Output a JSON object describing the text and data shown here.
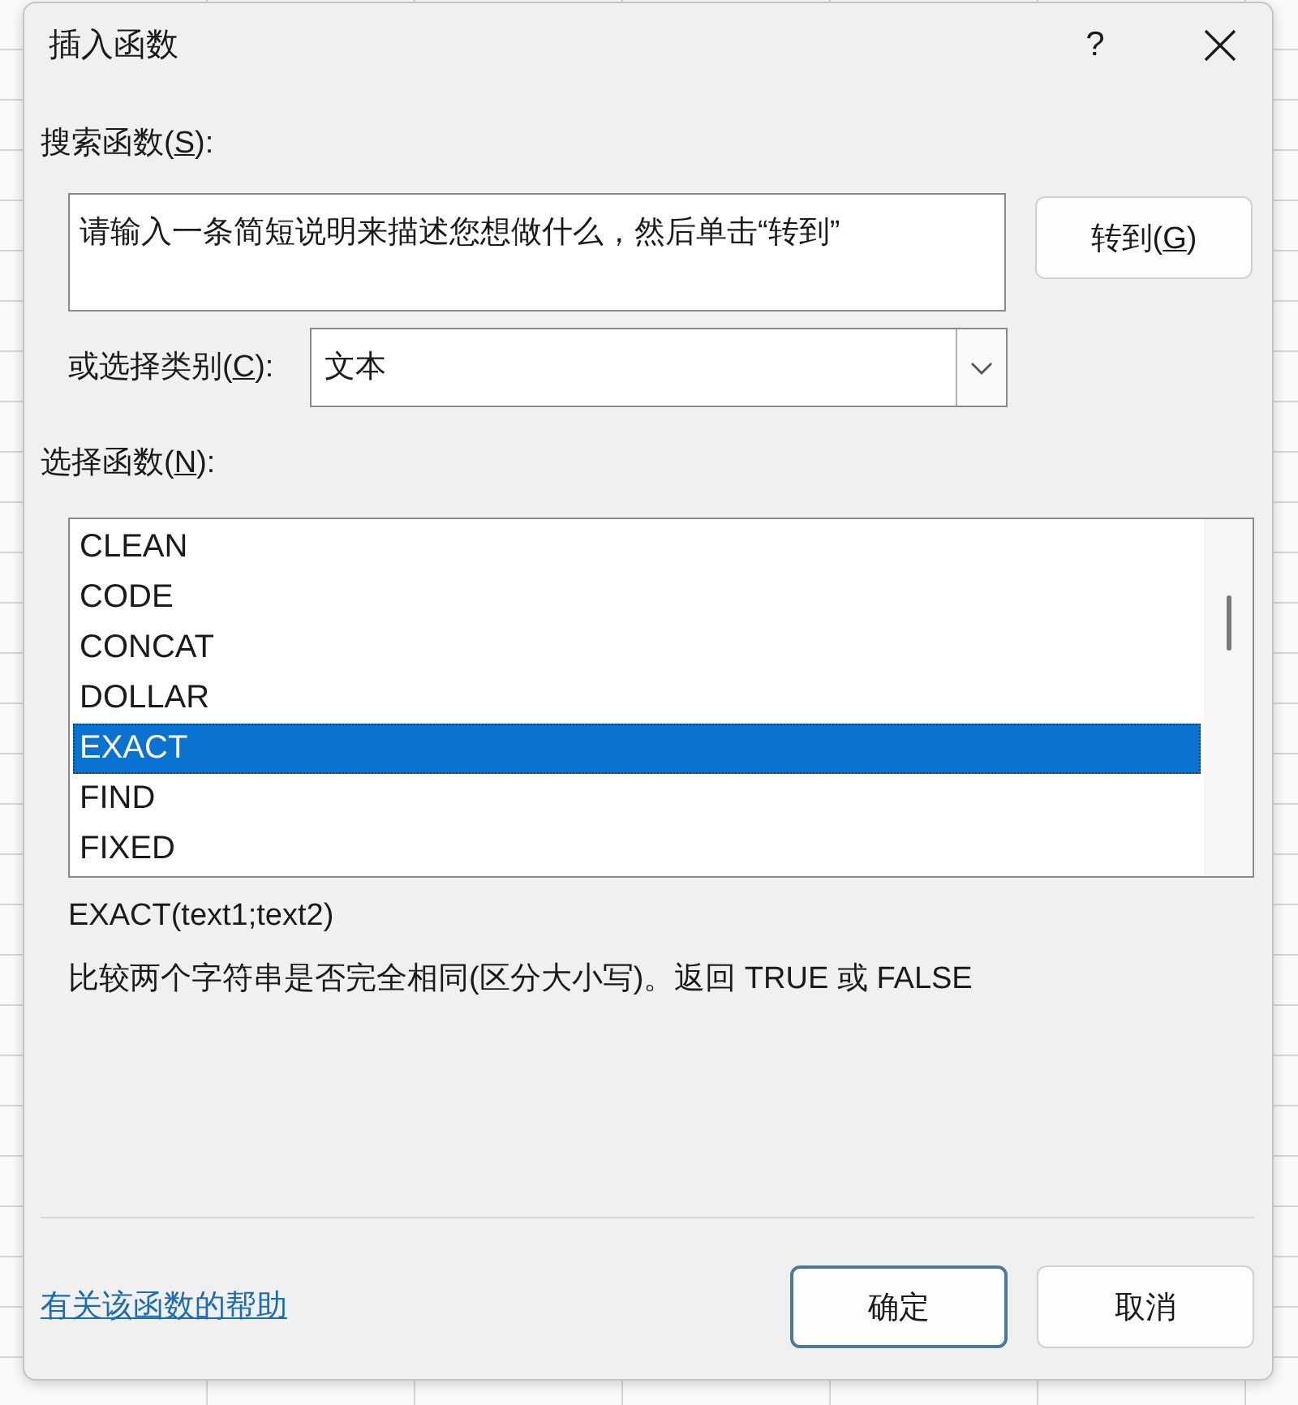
{
  "window": {
    "title": "插入函数",
    "help_button": "?"
  },
  "search": {
    "label": {
      "prefix": "搜索函数(",
      "key": "S",
      "suffix": "):"
    },
    "value": "请输入一条简短说明来描述您想做什么，然后单击“转到”",
    "go_button": {
      "prefix": "转到(",
      "key": "G",
      "suffix": ")"
    }
  },
  "category": {
    "label": {
      "prefix": "或选择类别(",
      "key": "C",
      "suffix": "):"
    },
    "value": "文本"
  },
  "functions": {
    "label": {
      "prefix": "选择函数(",
      "key": "N",
      "suffix": "):"
    },
    "items": [
      {
        "name": "CLEAN",
        "selected": false
      },
      {
        "name": "CODE",
        "selected": false
      },
      {
        "name": "CONCAT",
        "selected": false
      },
      {
        "name": "DOLLAR",
        "selected": false
      },
      {
        "name": "EXACT",
        "selected": true
      },
      {
        "name": "FIND",
        "selected": false
      },
      {
        "name": "FIXED",
        "selected": false
      }
    ]
  },
  "signature": "EXACT(text1;text2)",
  "description": "比较两个字符串是否完全相同(区分大小写)。返回 TRUE 或 FALSE",
  "help_link": "有关该函数的帮助",
  "buttons": [
    {
      "label": "确定",
      "default": true
    },
    {
      "label": "取消",
      "default": false
    }
  ]
}
